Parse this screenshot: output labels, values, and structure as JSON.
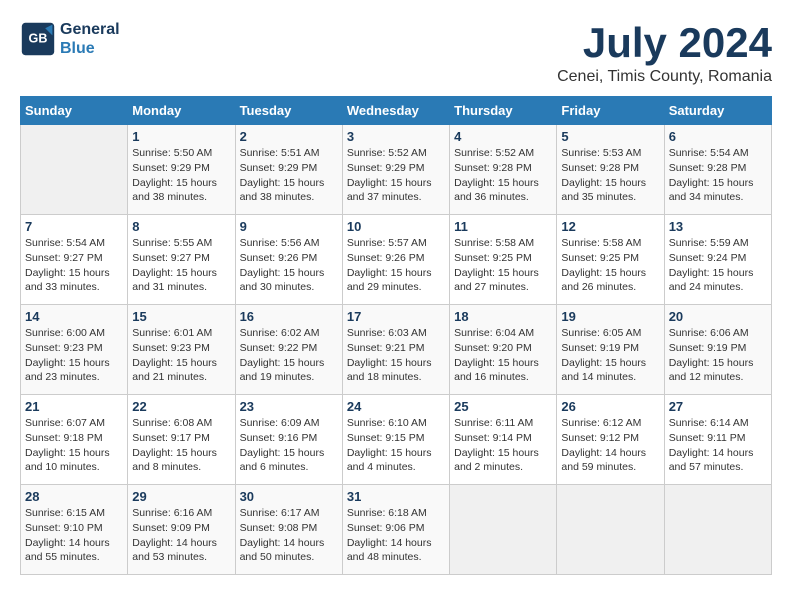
{
  "logo": {
    "text_general": "General",
    "text_blue": "Blue"
  },
  "title": {
    "month_year": "July 2024",
    "location": "Cenei, Timis County, Romania"
  },
  "days_of_week": [
    "Sunday",
    "Monday",
    "Tuesday",
    "Wednesday",
    "Thursday",
    "Friday",
    "Saturday"
  ],
  "weeks": [
    [
      {
        "day": "",
        "info": ""
      },
      {
        "day": "1",
        "info": "Sunrise: 5:50 AM\nSunset: 9:29 PM\nDaylight: 15 hours\nand 38 minutes."
      },
      {
        "day": "2",
        "info": "Sunrise: 5:51 AM\nSunset: 9:29 PM\nDaylight: 15 hours\nand 38 minutes."
      },
      {
        "day": "3",
        "info": "Sunrise: 5:52 AM\nSunset: 9:29 PM\nDaylight: 15 hours\nand 37 minutes."
      },
      {
        "day": "4",
        "info": "Sunrise: 5:52 AM\nSunset: 9:28 PM\nDaylight: 15 hours\nand 36 minutes."
      },
      {
        "day": "5",
        "info": "Sunrise: 5:53 AM\nSunset: 9:28 PM\nDaylight: 15 hours\nand 35 minutes."
      },
      {
        "day": "6",
        "info": "Sunrise: 5:54 AM\nSunset: 9:28 PM\nDaylight: 15 hours\nand 34 minutes."
      }
    ],
    [
      {
        "day": "7",
        "info": "Sunrise: 5:54 AM\nSunset: 9:27 PM\nDaylight: 15 hours\nand 33 minutes."
      },
      {
        "day": "8",
        "info": "Sunrise: 5:55 AM\nSunset: 9:27 PM\nDaylight: 15 hours\nand 31 minutes."
      },
      {
        "day": "9",
        "info": "Sunrise: 5:56 AM\nSunset: 9:26 PM\nDaylight: 15 hours\nand 30 minutes."
      },
      {
        "day": "10",
        "info": "Sunrise: 5:57 AM\nSunset: 9:26 PM\nDaylight: 15 hours\nand 29 minutes."
      },
      {
        "day": "11",
        "info": "Sunrise: 5:58 AM\nSunset: 9:25 PM\nDaylight: 15 hours\nand 27 minutes."
      },
      {
        "day": "12",
        "info": "Sunrise: 5:58 AM\nSunset: 9:25 PM\nDaylight: 15 hours\nand 26 minutes."
      },
      {
        "day": "13",
        "info": "Sunrise: 5:59 AM\nSunset: 9:24 PM\nDaylight: 15 hours\nand 24 minutes."
      }
    ],
    [
      {
        "day": "14",
        "info": "Sunrise: 6:00 AM\nSunset: 9:23 PM\nDaylight: 15 hours\nand 23 minutes."
      },
      {
        "day": "15",
        "info": "Sunrise: 6:01 AM\nSunset: 9:23 PM\nDaylight: 15 hours\nand 21 minutes."
      },
      {
        "day": "16",
        "info": "Sunrise: 6:02 AM\nSunset: 9:22 PM\nDaylight: 15 hours\nand 19 minutes."
      },
      {
        "day": "17",
        "info": "Sunrise: 6:03 AM\nSunset: 9:21 PM\nDaylight: 15 hours\nand 18 minutes."
      },
      {
        "day": "18",
        "info": "Sunrise: 6:04 AM\nSunset: 9:20 PM\nDaylight: 15 hours\nand 16 minutes."
      },
      {
        "day": "19",
        "info": "Sunrise: 6:05 AM\nSunset: 9:19 PM\nDaylight: 15 hours\nand 14 minutes."
      },
      {
        "day": "20",
        "info": "Sunrise: 6:06 AM\nSunset: 9:19 PM\nDaylight: 15 hours\nand 12 minutes."
      }
    ],
    [
      {
        "day": "21",
        "info": "Sunrise: 6:07 AM\nSunset: 9:18 PM\nDaylight: 15 hours\nand 10 minutes."
      },
      {
        "day": "22",
        "info": "Sunrise: 6:08 AM\nSunset: 9:17 PM\nDaylight: 15 hours\nand 8 minutes."
      },
      {
        "day": "23",
        "info": "Sunrise: 6:09 AM\nSunset: 9:16 PM\nDaylight: 15 hours\nand 6 minutes."
      },
      {
        "day": "24",
        "info": "Sunrise: 6:10 AM\nSunset: 9:15 PM\nDaylight: 15 hours\nand 4 minutes."
      },
      {
        "day": "25",
        "info": "Sunrise: 6:11 AM\nSunset: 9:14 PM\nDaylight: 15 hours\nand 2 minutes."
      },
      {
        "day": "26",
        "info": "Sunrise: 6:12 AM\nSunset: 9:12 PM\nDaylight: 14 hours\nand 59 minutes."
      },
      {
        "day": "27",
        "info": "Sunrise: 6:14 AM\nSunset: 9:11 PM\nDaylight: 14 hours\nand 57 minutes."
      }
    ],
    [
      {
        "day": "28",
        "info": "Sunrise: 6:15 AM\nSunset: 9:10 PM\nDaylight: 14 hours\nand 55 minutes."
      },
      {
        "day": "29",
        "info": "Sunrise: 6:16 AM\nSunset: 9:09 PM\nDaylight: 14 hours\nand 53 minutes."
      },
      {
        "day": "30",
        "info": "Sunrise: 6:17 AM\nSunset: 9:08 PM\nDaylight: 14 hours\nand 50 minutes."
      },
      {
        "day": "31",
        "info": "Sunrise: 6:18 AM\nSunset: 9:06 PM\nDaylight: 14 hours\nand 48 minutes."
      },
      {
        "day": "",
        "info": ""
      },
      {
        "day": "",
        "info": ""
      },
      {
        "day": "",
        "info": ""
      }
    ]
  ]
}
